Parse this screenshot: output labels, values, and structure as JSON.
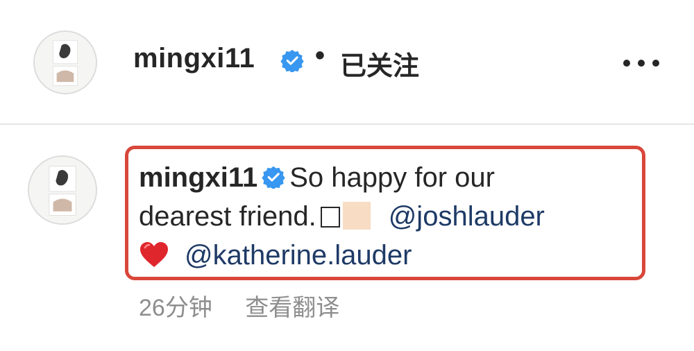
{
  "header": {
    "username": "mingxi11",
    "verified_icon": "verified-badge-icon",
    "separator": "•",
    "follow_status": "已关注",
    "more_icon": "more-horizontal-icon"
  },
  "comment": {
    "username": "mingxi11",
    "text_part1": "So happy for our",
    "text_part2": "dearest friend.",
    "mention1": "@joshlauder",
    "mention2": "@katherine.lauder",
    "heart_icon": "red-heart-emoji",
    "time": "26分钟",
    "translate_label": "查看翻译"
  },
  "colors": {
    "highlight_border": "#d8473a",
    "mention": "#1e3a66",
    "verified": "#3897f0",
    "meta_text": "#8e8e8e"
  }
}
